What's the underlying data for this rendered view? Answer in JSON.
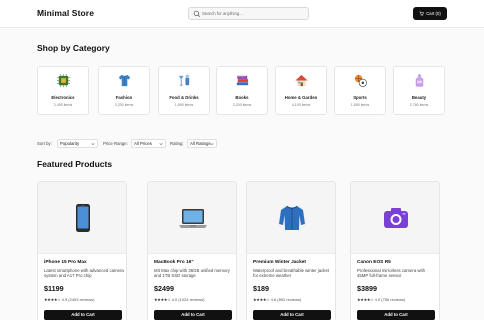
{
  "header": {
    "logo": "Minimal Store",
    "search_placeholder": "Search for anything...",
    "cart_label": "Cart (0)"
  },
  "categories_title": "Shop by Category",
  "categories": [
    {
      "name": "Electronics",
      "count": "2,450 items",
      "icon": "circuit-chip-icon"
    },
    {
      "name": "Fashion",
      "count": "3,200 items",
      "icon": "shirt-icon"
    },
    {
      "name": "Food & Drinks",
      "count": "1,890 items",
      "icon": "drinks-icon"
    },
    {
      "name": "Books",
      "count": "3,200 items",
      "icon": "books-icon"
    },
    {
      "name": "Home & Garden",
      "count": "4,100 items",
      "icon": "house-icon"
    },
    {
      "name": "Sports",
      "count": "1,650 items",
      "icon": "sports-balls-icon"
    },
    {
      "name": "Beauty",
      "count": "2,780 items",
      "icon": "perfume-icon"
    }
  ],
  "filters": {
    "sort_label": "Sort by:",
    "sort_value": "Popularity",
    "price_label": "Price Range:",
    "price_value": "All Prices",
    "rating_label": "Rating:",
    "rating_value": "All Ratings"
  },
  "featured_title": "Featured Products",
  "products": [
    {
      "name": "iPhone 15 Pro Max",
      "desc": "Latest smartphone with advanced camera system and A17 Pro chip",
      "price": "$1199",
      "stars": "★★★★☆",
      "rating": "4.9 (2453 reviews)",
      "button": "Add to Cart",
      "icon": "smartphone-icon"
    },
    {
      "name": "MacBook Pro 16\"",
      "desc": "M3 Max chip with 36GB unified memory and 1TB SSD storage",
      "price": "$2499",
      "stars": "★★★★☆",
      "rating": "4.9 (1024 reviews)",
      "button": "Add to Cart",
      "icon": "laptop-icon"
    },
    {
      "name": "Premium Winter Jacket",
      "desc": "Waterproof and breathable winter jacket for extreme weather",
      "price": "$189",
      "stars": "★★★★☆",
      "rating": "4.6 (892 reviews)",
      "button": "Add to Cart",
      "icon": "jacket-icon"
    },
    {
      "name": "Canon EOS R5",
      "desc": "Professional mirrorless camera with 45MP full-frame sensor",
      "price": "$3899",
      "stars": "★★★★☆",
      "rating": "4.9 (756 reviews)",
      "button": "Add to Cart",
      "icon": "camera-icon"
    }
  ]
}
